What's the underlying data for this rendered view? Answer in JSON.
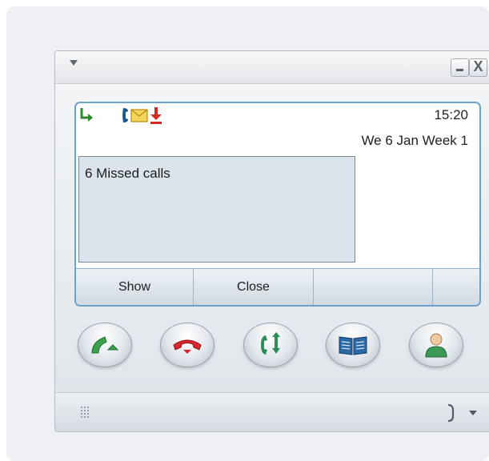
{
  "window": {
    "minimize_glyph": "",
    "close_glyph": "X"
  },
  "status": {
    "icons": [
      "call-forward-icon",
      "voicemail-icon",
      "message-envelope-icon",
      "download-arrow-icon"
    ],
    "time": "15:20",
    "date": "We 6 Jan Week 1"
  },
  "message": {
    "text": "6 Missed calls"
  },
  "softkeys": [
    {
      "label": "Show"
    },
    {
      "label": "Close"
    },
    {
      "label": ""
    },
    {
      "label": ""
    }
  ],
  "actions": [
    {
      "icon": "answer-call-icon"
    },
    {
      "icon": "hang-up-icon"
    },
    {
      "icon": "transfer-call-icon"
    },
    {
      "icon": "phonebook-icon"
    },
    {
      "icon": "contacts-person-icon"
    }
  ],
  "bottombar": {
    "grip_icon": "resize-grip-icon",
    "hook_icon": "handset-hook-icon"
  },
  "colors": {
    "screen_border": "#6fa1c9",
    "answer_green": "#3ca04b",
    "hangup_red": "#d9262f",
    "message_bg": "#dbe4ec"
  }
}
